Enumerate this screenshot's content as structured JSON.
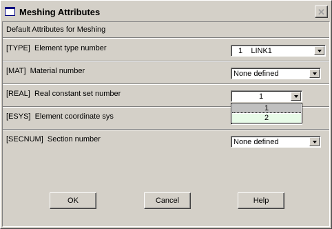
{
  "window": {
    "title": "Meshing Attributes",
    "close_glyph": "✕"
  },
  "header": {
    "text": "Default Attributes for Meshing"
  },
  "rows": [
    {
      "label": "[TYPE]  Element type number",
      "value": "1    LINK1"
    },
    {
      "label": "[MAT]  Material number",
      "value": "None defined"
    },
    {
      "label": "[REAL]  Real constant set number",
      "value": "1"
    },
    {
      "label": "[ESYS]  Element coordinate sys",
      "value": ""
    },
    {
      "label": "[SECNUM]  Section number",
      "value": "None defined"
    }
  ],
  "real_dropdown": {
    "options": [
      "1",
      "2"
    ],
    "selected_index": 0,
    "highlighted_index": 1
  },
  "buttons": {
    "ok": "OK",
    "cancel": "Cancel",
    "help": "Help"
  },
  "colors": {
    "face": "#d4d0c8",
    "title_icon": "#000080",
    "highlight": "#e8fbe8"
  }
}
